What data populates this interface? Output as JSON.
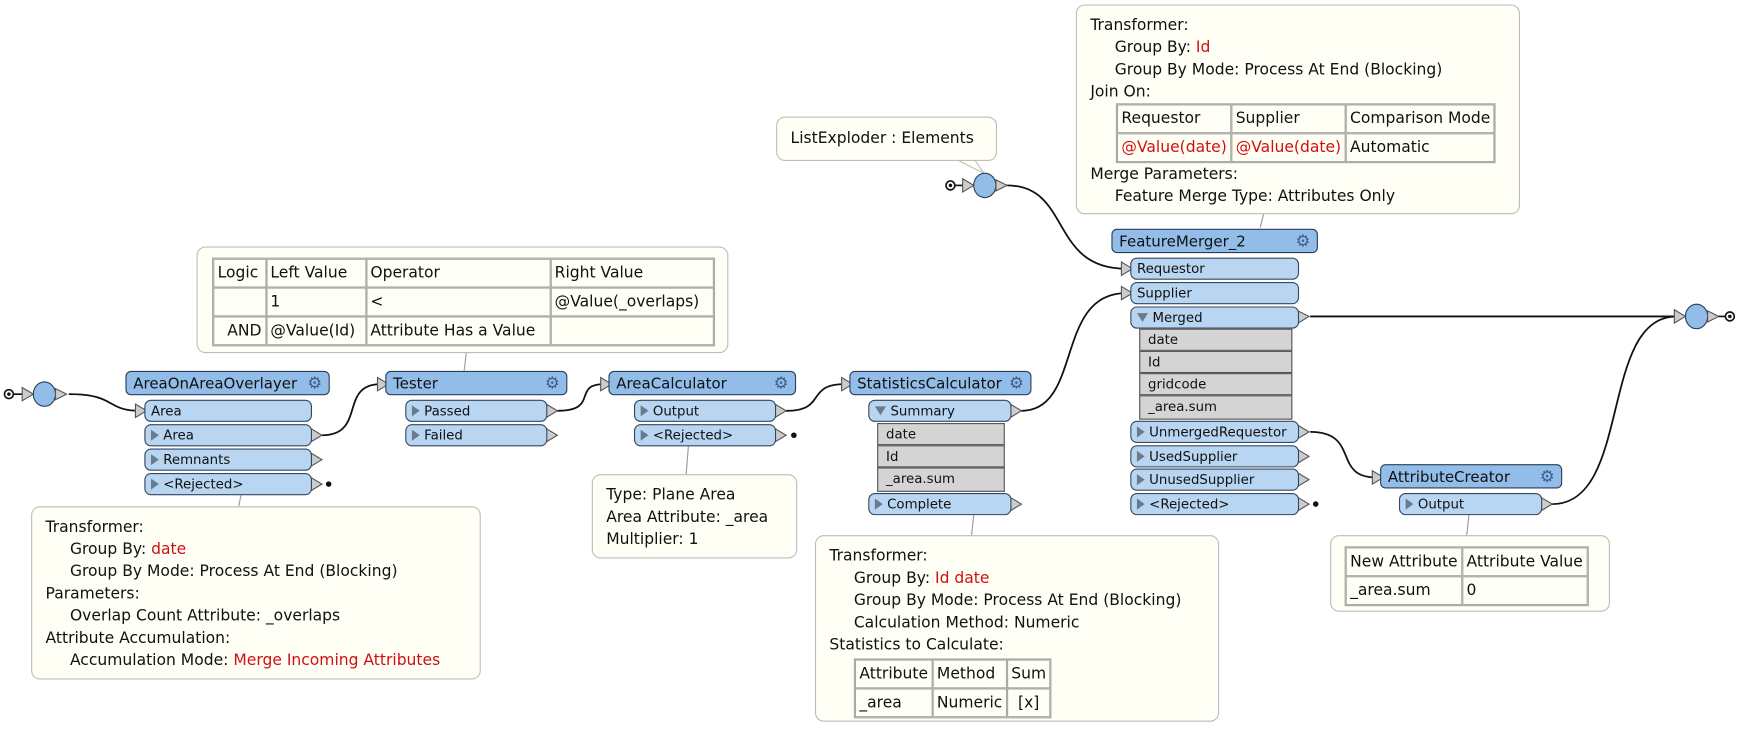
{
  "colors": {
    "node_header": "#92bde9",
    "port": "#b8d5f1",
    "attribute_row": "#d4d4d4",
    "annotation_bg": "#fffff5",
    "highlight": "#d01010"
  },
  "list_exploder": {
    "annotation": "ListExploder : Elements"
  },
  "area_on_area": {
    "title": "AreaOnAreaOverlayer",
    "input": "Area",
    "outputs": [
      "Area",
      "Remnants",
      "<Rejected>"
    ],
    "annotation": {
      "l1": "Transformer:",
      "l2k": "Group By: ",
      "l2v": "date",
      "l3": "Group By Mode: Process At End (Blocking)",
      "l4": "Parameters:",
      "l5": "Overlap Count Attribute: _overlaps",
      "l6": "Attribute Accumulation:",
      "l7k": "Accumulation Mode: ",
      "l7v": "Merge Incoming Attributes"
    }
  },
  "tester": {
    "title": "Tester",
    "outputs": [
      "Passed",
      "Failed"
    ],
    "table": {
      "headers": [
        "Logic",
        "Left Value",
        "Operator",
        "Right Value"
      ],
      "rows": [
        [
          "",
          "1",
          "<",
          "@Value(_overlaps)"
        ],
        [
          "AND",
          "@Value(Id)",
          "Attribute Has a Value",
          ""
        ]
      ]
    }
  },
  "area_calculator": {
    "title": "AreaCalculator",
    "outputs": [
      "Output",
      "<Rejected>"
    ],
    "annotation": {
      "l1": "Type: Plane Area",
      "l2": "Area Attribute: _area",
      "l3": "Multiplier: 1"
    }
  },
  "statistics": {
    "title": "StatisticsCalculator",
    "summary": "Summary",
    "attributes": [
      "date",
      "Id",
      "_area.sum"
    ],
    "complete": "Complete",
    "annotation": {
      "l1": "Transformer:",
      "l2k": "Group By: ",
      "l2v": "Id date",
      "l3": "Group By Mode: Process At End (Blocking)",
      "l4": "Calculation Method: Numeric",
      "l5": "Statistics to Calculate:"
    },
    "table": {
      "headers": [
        "Attribute",
        "Method",
        "Sum"
      ],
      "rows": [
        [
          "_area",
          "Numeric",
          "[x]"
        ]
      ]
    }
  },
  "feature_merger": {
    "title": "FeatureMerger_2",
    "inputs": [
      "Requestor",
      "Supplier"
    ],
    "merged": "Merged",
    "attributes": [
      "date",
      "Id",
      "gridcode",
      "_area.sum"
    ],
    "outputs": [
      "UnmergedRequestor",
      "UsedSupplier",
      "UnusedSupplier",
      "<Rejected>"
    ],
    "annotation": {
      "l1": "Transformer:",
      "l2k": "Group By: ",
      "l2v": "Id",
      "l3": "Group By Mode: Process At End (Blocking)",
      "l4": "Join On:",
      "l5": "Merge Parameters:",
      "l6": "Feature Merge Type: Attributes Only"
    },
    "table": {
      "headers": [
        "Requestor",
        "Supplier",
        "Comparison Mode"
      ],
      "rows": [
        [
          "@Value(date)",
          "@Value(date)",
          "Automatic"
        ]
      ]
    }
  },
  "attribute_creator": {
    "title": "AttributeCreator",
    "output": "Output",
    "table": {
      "headers": [
        "New Attribute",
        "Attribute Value"
      ],
      "rows": [
        [
          "_area.sum",
          "0"
        ]
      ]
    }
  }
}
